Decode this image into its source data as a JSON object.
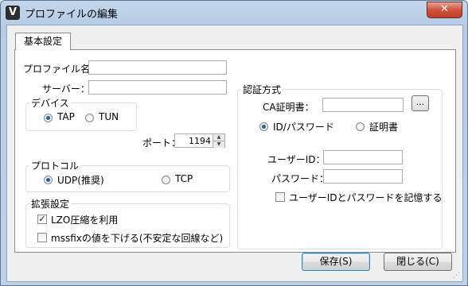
{
  "window": {
    "title": "プロファイルの編集",
    "app_icon_letter": "V",
    "close_symbol": "✕"
  },
  "tabs": [
    {
      "label": "基本設定"
    }
  ],
  "profile": {
    "name_label": "プロファイル名：",
    "name_value": "",
    "server_label": "サーバー：",
    "server_value": ""
  },
  "device": {
    "legend": "デバイス",
    "options": [
      "TAP",
      "TUN"
    ],
    "selected": "TAP"
  },
  "port": {
    "label": "ポート：",
    "value": "1194"
  },
  "protocol": {
    "legend": "プロトコル",
    "options": [
      "UDP(推奨)",
      "TCP"
    ],
    "selected": "UDP(推奨)"
  },
  "extended": {
    "legend": "拡張設定",
    "lzo_label": "LZO圧縮を利用",
    "lzo_checked": true,
    "mssfix_label": "mssfixの値を下げる(不安定な回線など)",
    "mssfix_checked": false
  },
  "auth": {
    "legend": "認証方式",
    "ca_label": "CA証明書：",
    "ca_value": "",
    "browse_label": "...",
    "options": [
      "ID/パスワード",
      "証明書"
    ],
    "selected": "ID/パスワード",
    "user_label": "ユーザーID：",
    "user_value": "",
    "pass_label": "パスワード：",
    "pass_value": "",
    "remember_label": "ユーザーIDとパスワードを記憶する",
    "remember_checked": false
  },
  "buttons": {
    "save": "保存(S)",
    "close": "閉じる(C)"
  },
  "colors": {
    "title_bg": "#bcd0e8",
    "close_btn": "#c8452b",
    "radio_dot": "#1d5fa8"
  }
}
